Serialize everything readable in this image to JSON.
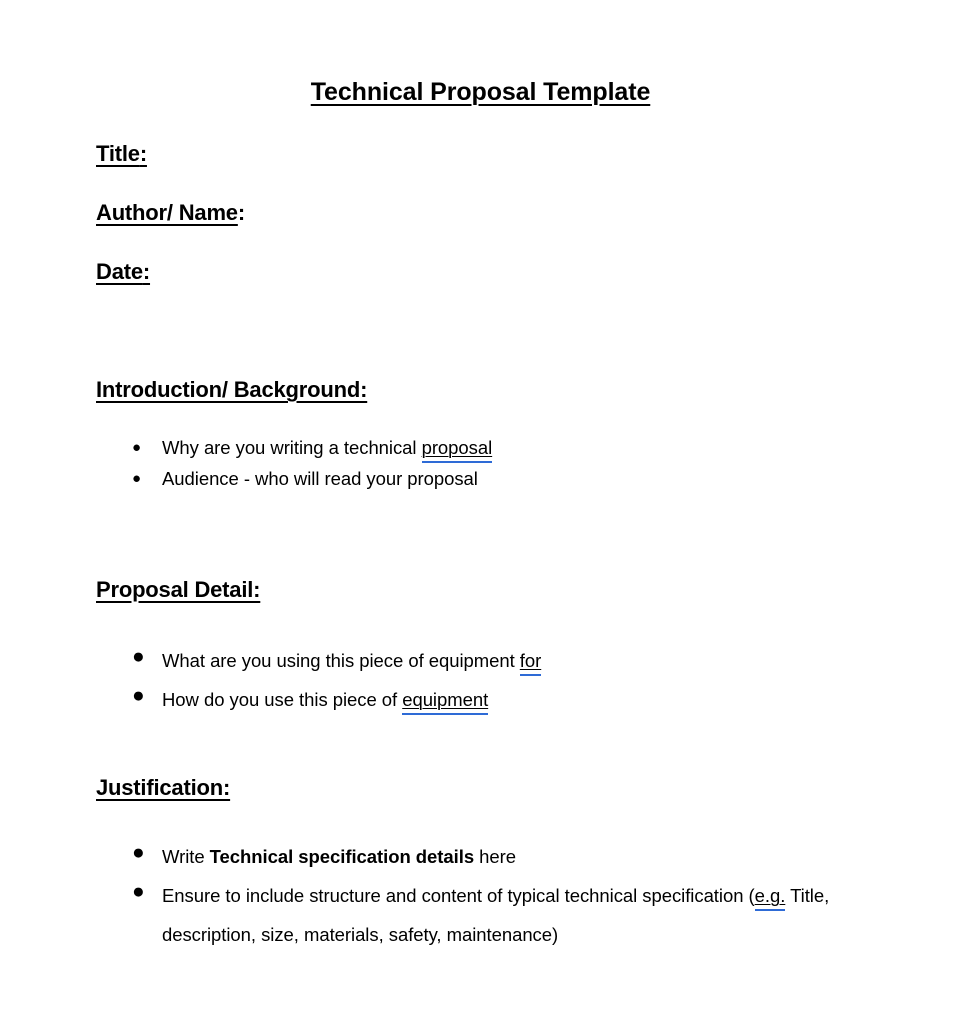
{
  "document": {
    "title": "Technical Proposal Template",
    "fields": [
      {
        "label": "Title",
        "colon": ":"
      },
      {
        "label": "Author/ Name",
        "colon": ":"
      },
      {
        "label": "Date",
        "colon": ":"
      }
    ],
    "sections": [
      {
        "heading": "Introduction/ Background:",
        "bullets": [
          {
            "bullet_glyph": "●",
            "parts": [
              {
                "text": "Why are you writing a technical ",
                "style": "normal"
              },
              {
                "text": "proposal",
                "style": "grammar-flagged"
              }
            ]
          },
          {
            "bullet_glyph": "●",
            "parts": [
              {
                "text": "Audience - who will read your proposal",
                "style": "normal"
              }
            ]
          }
        ]
      },
      {
        "heading": "Proposal Detail:",
        "bullets": [
          {
            "bullet_glyph": "●",
            "parts": [
              {
                "text": "What are you using this piece of equipment ",
                "style": "normal"
              },
              {
                "text": "for",
                "style": "grammar-flagged"
              }
            ]
          },
          {
            "bullet_glyph": "●",
            "parts": [
              {
                "text": "How do you use this piece of ",
                "style": "normal"
              },
              {
                "text": "equipment",
                "style": "grammar-flagged"
              }
            ]
          }
        ]
      },
      {
        "heading": "Justification:",
        "bullets": [
          {
            "bullet_glyph": "●",
            "parts": [
              {
                "text": "Write ",
                "style": "normal"
              },
              {
                "text": "Technical specification details",
                "style": "bold"
              },
              {
                "text": " here",
                "style": "normal"
              }
            ]
          },
          {
            "bullet_glyph": "●",
            "parts": [
              {
                "text": "Ensure to include structure and content of typical technical specification (",
                "style": "normal"
              },
              {
                "text": "e.g.",
                "style": "grammar-flagged"
              },
              {
                "text": " Title, description, size, materials, safety, maintenance)",
                "style": "normal"
              }
            ]
          }
        ]
      }
    ],
    "colors": {
      "text": "#000000",
      "page_background": "#ffffff",
      "grammar_underline": "#2E6BD6"
    }
  }
}
